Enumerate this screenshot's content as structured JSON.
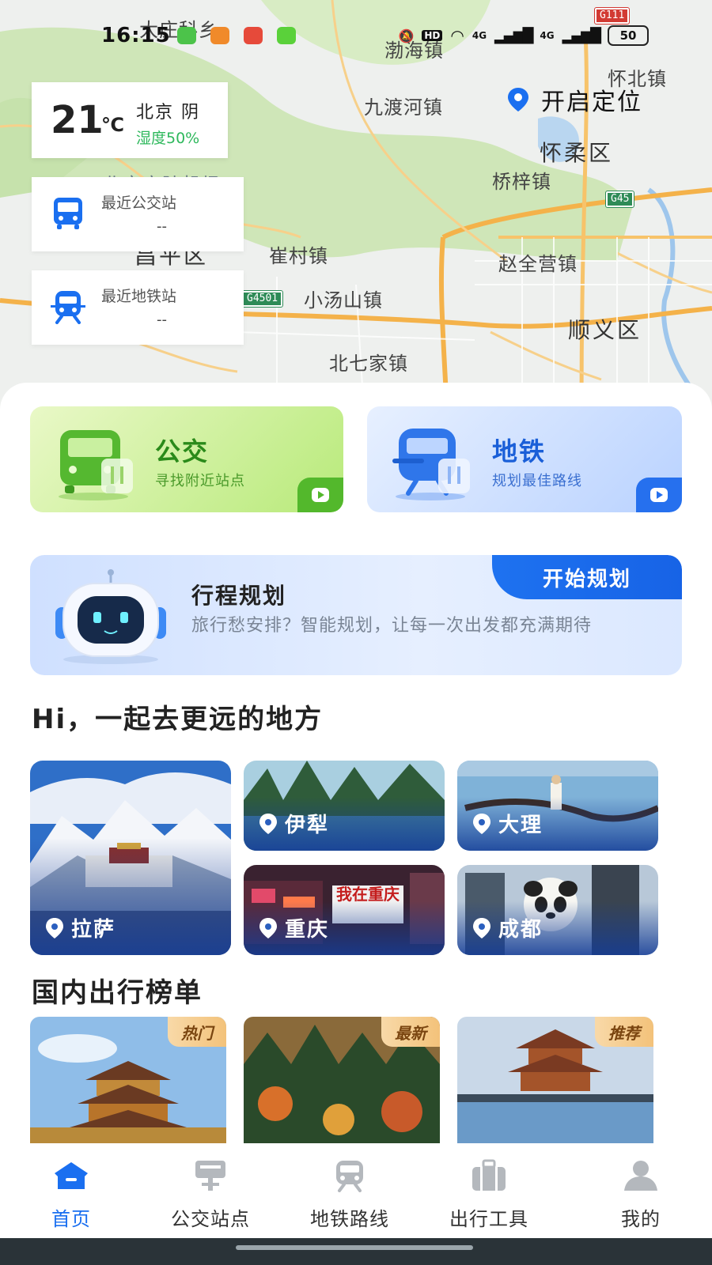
{
  "status_bar": {
    "time": "16:15",
    "signal_1": "4G",
    "signal_2": "4G",
    "hd": "HD",
    "battery": "50"
  },
  "map": {
    "labels": [
      "大庄科乡",
      "渤海镇",
      "怀北镇",
      "九渡河镇",
      "怀柔区",
      "桥梓镇",
      "北京定陵机场",
      "崔村镇",
      "赵全营镇",
      "小汤山镇",
      "顺义区",
      "北七家镇",
      "昌平区"
    ],
    "highways": [
      "G111",
      "G45",
      "G4501"
    ]
  },
  "locate": {
    "label": "开启定位"
  },
  "weather": {
    "temp": "21",
    "unit": "℃",
    "city": "北京 阴",
    "humidity": "湿度50%"
  },
  "bus_station": {
    "label": "最近公交站",
    "value": "--"
  },
  "metro_station": {
    "label": "最近地铁站",
    "value": "--"
  },
  "cards": {
    "bus": {
      "title": "公交",
      "subtitle": "寻找附近站点"
    },
    "metro": {
      "title": "地铁",
      "subtitle": "规划最佳路线"
    }
  },
  "trip_plan": {
    "title": "行程规划",
    "description": "旅行愁安排？智能规划，让每一次出发都充满期待",
    "button": "开始规划"
  },
  "destinations": {
    "title": "Hi，一起去更远的地方",
    "items": [
      "拉萨",
      "伊犁",
      "大理",
      "重庆",
      "成都"
    ],
    "sign_text": "我在重庆"
  },
  "ranking": {
    "title": "国内出行榜单",
    "tags": [
      "热门",
      "最新",
      "推荐"
    ]
  },
  "nav": {
    "items": [
      "首页",
      "公交站点",
      "地铁路线",
      "出行工具",
      "我的"
    ],
    "active": "首页"
  },
  "colors": {
    "primary": "#1a6ff0",
    "bus_green": "#53b82c",
    "humidity_green": "#2eb85c"
  }
}
